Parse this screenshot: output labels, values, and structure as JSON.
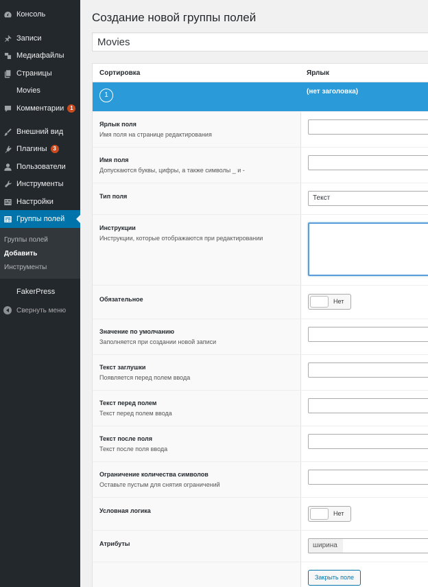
{
  "sidebar": {
    "items": [
      {
        "label": "Консоль",
        "icon": "dashboard-icon"
      },
      {
        "label": "Записи",
        "icon": "pin-icon"
      },
      {
        "label": "Медиафайлы",
        "icon": "media-icon"
      },
      {
        "label": "Страницы",
        "icon": "pages-icon"
      },
      {
        "label": "Movies",
        "icon": ""
      },
      {
        "label": "Комментарии",
        "icon": "comment-icon",
        "badge": "1"
      },
      {
        "label": "Внешний вид",
        "icon": "brush-icon"
      },
      {
        "label": "Плагины",
        "icon": "plugin-icon",
        "badge": "3"
      },
      {
        "label": "Пользователи",
        "icon": "user-icon"
      },
      {
        "label": "Инструменты",
        "icon": "wrench-icon"
      },
      {
        "label": "Настройки",
        "icon": "settings-icon"
      },
      {
        "label": "Группы полей",
        "icon": "table-icon"
      },
      {
        "label": "FakerPress",
        "icon": ""
      }
    ],
    "submenu": [
      "Группы полей",
      "Добавить",
      "Инструменты"
    ],
    "collapse_label": "Свернуть меню"
  },
  "main": {
    "title": "Создание новой группы полей",
    "group_title_value": "Movies",
    "table_head": {
      "order": "Сортировка",
      "label": "Ярлык"
    },
    "field": {
      "order": "1",
      "title": "(нет заголовка)"
    },
    "rows": [
      {
        "title": "Ярлык поля",
        "desc": "Имя поля на странице редактирования"
      },
      {
        "title": "Имя поля",
        "desc": "Допускаются буквы, цифры, а также символы _ и -"
      },
      {
        "title": "Тип поля",
        "desc": "",
        "value": "Текст"
      },
      {
        "title": "Инструкции",
        "desc": "Инструкции, которые отображаются при редактировании"
      },
      {
        "title": "Обязательное",
        "desc": "",
        "toggle": "Нет"
      },
      {
        "title": "Значение по умолчанию",
        "desc": "Заполняется при создании новой записи"
      },
      {
        "title": "Текст заглушки",
        "desc": "Появляется перед полем ввода"
      },
      {
        "title": "Текст перед полем",
        "desc": "Текст перед полем ввода"
      },
      {
        "title": "Текст после поля",
        "desc": "Текст после поля ввода"
      },
      {
        "title": "Ограничение количества символов",
        "desc": "Оставьте пустым для снятия ограничений"
      },
      {
        "title": "Условная логика",
        "desc": "",
        "toggle": "Нет"
      },
      {
        "title": "Атрибуты",
        "desc": "",
        "prefix": "ширина"
      }
    ],
    "close_button": "Закрыть поле"
  },
  "colors": {
    "sidebar_bg": "#23282d",
    "active": "#0073aa",
    "field_header": "#2a9ad9",
    "badge": "#ca4a1f"
  }
}
